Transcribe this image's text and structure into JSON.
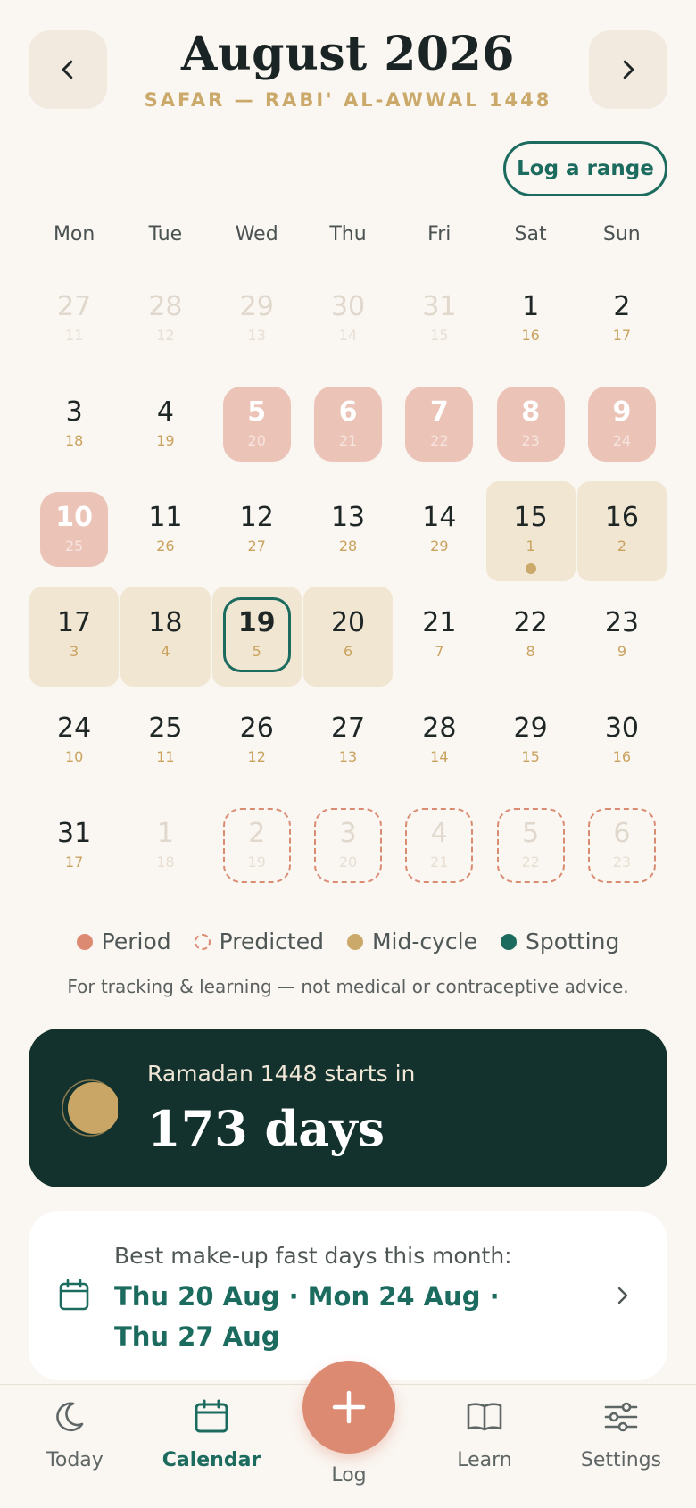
{
  "header": {
    "title": "August 2026",
    "subtitle": "SAFAR — RABI' AL-AWWAL 1448",
    "prev_icon": "chevron-left-icon",
    "next_icon": "chevron-right-icon",
    "range_button": "Log a range"
  },
  "weekdays": [
    "Mon",
    "Tue",
    "Wed",
    "Thu",
    "Fri",
    "Sat",
    "Sun"
  ],
  "weeks": [
    [
      {
        "d": "27",
        "h": "11",
        "state": "muted"
      },
      {
        "d": "28",
        "h": "12",
        "state": "muted"
      },
      {
        "d": "29",
        "h": "13",
        "state": "muted"
      },
      {
        "d": "30",
        "h": "14",
        "state": "muted"
      },
      {
        "d": "31",
        "h": "15",
        "state": "muted"
      },
      {
        "d": "1",
        "h": "16",
        "state": "normal"
      },
      {
        "d": "2",
        "h": "17",
        "state": "normal"
      }
    ],
    [
      {
        "d": "3",
        "h": "18",
        "state": "normal"
      },
      {
        "d": "4",
        "h": "19",
        "state": "normal"
      },
      {
        "d": "5",
        "h": "20",
        "state": "period"
      },
      {
        "d": "6",
        "h": "21",
        "state": "period"
      },
      {
        "d": "7",
        "h": "22",
        "state": "period"
      },
      {
        "d": "8",
        "h": "23",
        "state": "period"
      },
      {
        "d": "9",
        "h": "24",
        "state": "period"
      }
    ],
    [
      {
        "d": "10",
        "h": "25",
        "state": "period"
      },
      {
        "d": "11",
        "h": "26",
        "state": "normal"
      },
      {
        "d": "12",
        "h": "27",
        "state": "normal"
      },
      {
        "d": "13",
        "h": "28",
        "state": "normal"
      },
      {
        "d": "14",
        "h": "29",
        "state": "normal"
      },
      {
        "d": "15",
        "h": "1",
        "state": "midcycle",
        "dot": true
      },
      {
        "d": "16",
        "h": "2",
        "state": "midcycle"
      }
    ],
    [
      {
        "d": "17",
        "h": "3",
        "state": "midcycle"
      },
      {
        "d": "18",
        "h": "4",
        "state": "midcycle"
      },
      {
        "d": "19",
        "h": "5",
        "state": "midcycle",
        "today": true
      },
      {
        "d": "20",
        "h": "6",
        "state": "midcycle"
      },
      {
        "d": "21",
        "h": "7",
        "state": "normal"
      },
      {
        "d": "22",
        "h": "8",
        "state": "normal"
      },
      {
        "d": "23",
        "h": "9",
        "state": "normal"
      }
    ],
    [
      {
        "d": "24",
        "h": "10",
        "state": "normal"
      },
      {
        "d": "25",
        "h": "11",
        "state": "normal"
      },
      {
        "d": "26",
        "h": "12",
        "state": "normal"
      },
      {
        "d": "27",
        "h": "13",
        "state": "normal"
      },
      {
        "d": "28",
        "h": "14",
        "state": "normal"
      },
      {
        "d": "29",
        "h": "15",
        "state": "normal"
      },
      {
        "d": "30",
        "h": "16",
        "state": "normal"
      }
    ],
    [
      {
        "d": "31",
        "h": "17",
        "state": "normal"
      },
      {
        "d": "1",
        "h": "18",
        "state": "muted"
      },
      {
        "d": "2",
        "h": "19",
        "state": "predicted"
      },
      {
        "d": "3",
        "h": "20",
        "state": "predicted"
      },
      {
        "d": "4",
        "h": "21",
        "state": "predicted"
      },
      {
        "d": "5",
        "h": "22",
        "state": "predicted"
      },
      {
        "d": "6",
        "h": "23",
        "state": "predicted"
      }
    ]
  ],
  "legend": [
    {
      "label": "Period",
      "color": "#DD8A73",
      "style": "solid"
    },
    {
      "label": "Predicted",
      "color": "#DD8A73",
      "style": "dashed"
    },
    {
      "label": "Mid-cycle",
      "color": "#CBA96A",
      "style": "solid"
    },
    {
      "label": "Spotting",
      "color": "#1C6B5F",
      "style": "solid"
    }
  ],
  "disclaimer": "For tracking & learning — not medical or contraceptive advice.",
  "ramadan": {
    "label": "Ramadan 1448 starts in",
    "countdown": "173 days",
    "icon": "moon-icon"
  },
  "fast_card": {
    "label": "Best make-up fast days this month:",
    "days": "Thu 20 Aug · Mon 24 Aug · Thu 27 Aug",
    "icon": "calendar-icon"
  },
  "tabbar": {
    "items": [
      {
        "label": "Today",
        "icon": "moon-icon"
      },
      {
        "label": "Calendar",
        "icon": "calendar-icon",
        "active": true
      },
      {
        "label": "Log",
        "icon": "plus-icon"
      },
      {
        "label": "Learn",
        "icon": "book-icon"
      },
      {
        "label": "Settings",
        "icon": "sliders-icon"
      }
    ]
  },
  "colors": {
    "background": "#FAF6F1",
    "accent": "#1C6B5F",
    "period": "#EBC3B7",
    "midcycle": "#F1E6D2",
    "gold": "#CBA96A",
    "fab": "#DD8A73",
    "dark_card": "#13322E"
  }
}
